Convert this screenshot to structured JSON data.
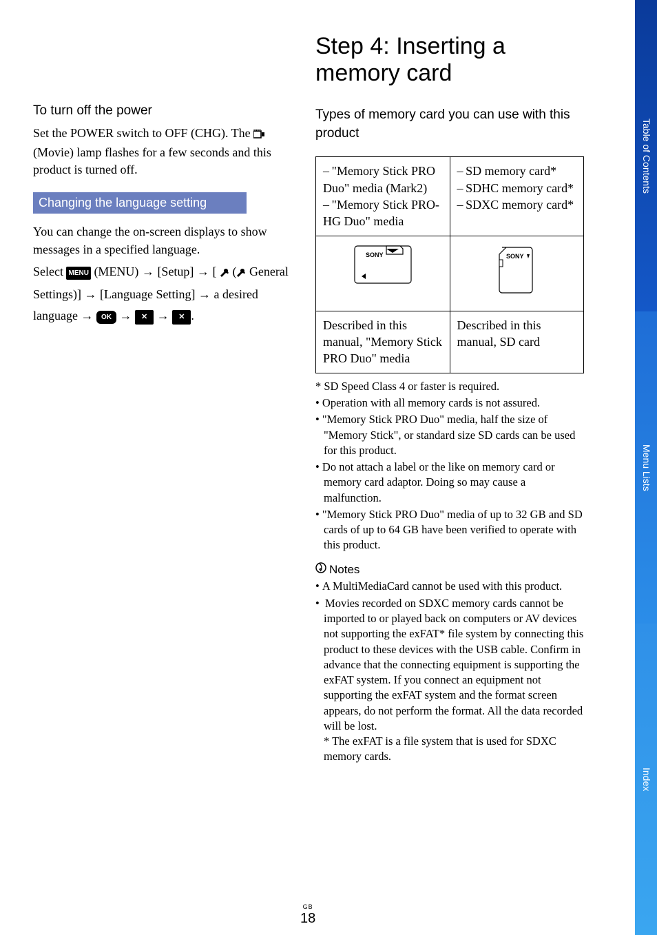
{
  "tabs": {
    "toc": "Table of Contents",
    "menu": "Menu Lists",
    "index": "Index"
  },
  "left": {
    "h_power": "To turn off the power",
    "p_power_1": "Set the POWER switch to OFF (CHG). The ",
    "p_power_2": " (Movie) lamp flashes for a few seconds and this product is turned off.",
    "h_lang": "Changing the language setting",
    "p_lang_1": "You can change the on-screen displays to show messages in a specified language.",
    "p_lang_select": "Select ",
    "p_lang_menu": " (MENU) ",
    "p_lang_setup": " [Setup] ",
    "p_lang_brk": " [",
    "p_lang_gs_open": " ( ",
    "p_lang_gs": " General Settings)] ",
    "p_lang_ls": " [Language Setting] ",
    "p_lang_desired": " a desired language ",
    "menu_badge": "MENU",
    "ok_badge": "OK",
    "x_badge": "✕"
  },
  "right": {
    "h_step": "Step 4: Inserting a memory card",
    "h_types": "Types of memory card you can use with this product",
    "table": {
      "r1c1": [
        "\"Memory Stick PRO Duo\" media (Mark2)",
        "\"Memory Stick PRO-HG Duo\" media"
      ],
      "r1c2": [
        "SD memory card*",
        "SDHC memory card*",
        "SDXC memory card*"
      ],
      "r3c1": "Described in this manual, \"Memory Stick PRO Duo\" media",
      "r3c2": "Described in this manual, SD card",
      "sony": "SONY"
    },
    "foot1": "SD Speed Class 4 or faster is required.",
    "foot2": "Operation with all memory cards is not assured.",
    "foot3": "\"Memory Stick PRO Duo\" media, half the size of \"Memory Stick\", or standard size SD cards can be used for this product.",
    "foot4": "Do not attach a label or the like on memory card or memory card adaptor. Doing so may cause a malfunction.",
    "foot5": "\"Memory Stick PRO Duo\" media of up to 32 GB and SD cards of up to 64 GB have been verified to operate with this product.",
    "notes_label": "Notes",
    "note1": "A MultiMediaCard cannot be used with this product.",
    "note2": "Movies recorded on SDXC memory cards cannot be imported to or played back on computers or AV devices not supporting the exFAT* file system by connecting this product to these devices with the USB cable. Confirm in advance that the connecting equipment is supporting the exFAT system. If you connect an equipment not supporting the exFAT system and the format screen appears, do not perform the format. All the data recorded will be lost.",
    "note2b": "* The exFAT is a file system that is used for SDXC memory cards."
  },
  "page": {
    "gb": "GB",
    "num": "18"
  }
}
